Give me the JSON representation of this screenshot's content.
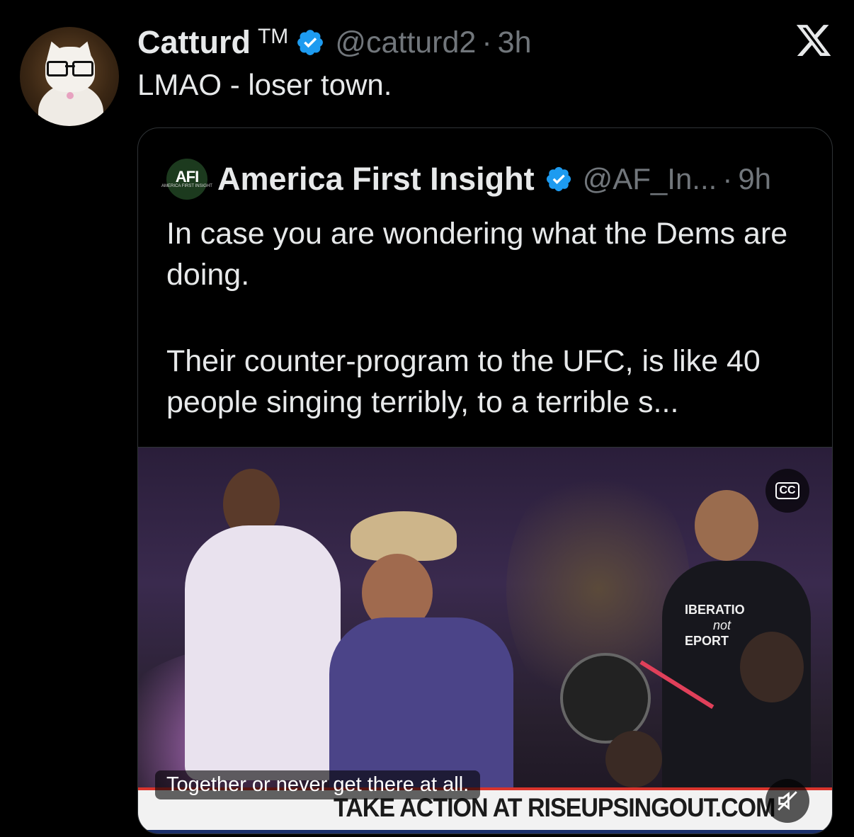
{
  "author": {
    "name": "Catturd",
    "tm": "TM",
    "handle": "@catturd2",
    "separator": "·",
    "time": "3h",
    "verified": true
  },
  "tweet": {
    "text": "LMAO - loser town."
  },
  "x_logo_icon": "x-logo-icon",
  "quoted": {
    "logo_text": "AFI",
    "logo_subtext": "AMERICA FIRST INSIGHT",
    "name": "America First Insight",
    "handle": "@AF_In...",
    "separator": "·",
    "time": "9h",
    "verified": true,
    "text_line1": "In case you are wondering what the Dems are doing.",
    "text_line2": "Their counter-program to the UFC, is like 40 people singing terribly, to a terrible s..."
  },
  "video": {
    "cc_label": "CC",
    "caption": "Together or never get there at all.",
    "banner": "TAKE ACTION AT RISEUPSINGOUT.COM",
    "shirt_text_1": "IBERATIO",
    "shirt_text_2": "not",
    "shirt_text_3": "EPORT",
    "mute_icon": "speaker-muted-icon"
  },
  "colors": {
    "background": "#000000",
    "text": "#e7e9ea",
    "secondary": "#71767b",
    "verified": "#1d9bf0",
    "border": "#2f3336"
  }
}
